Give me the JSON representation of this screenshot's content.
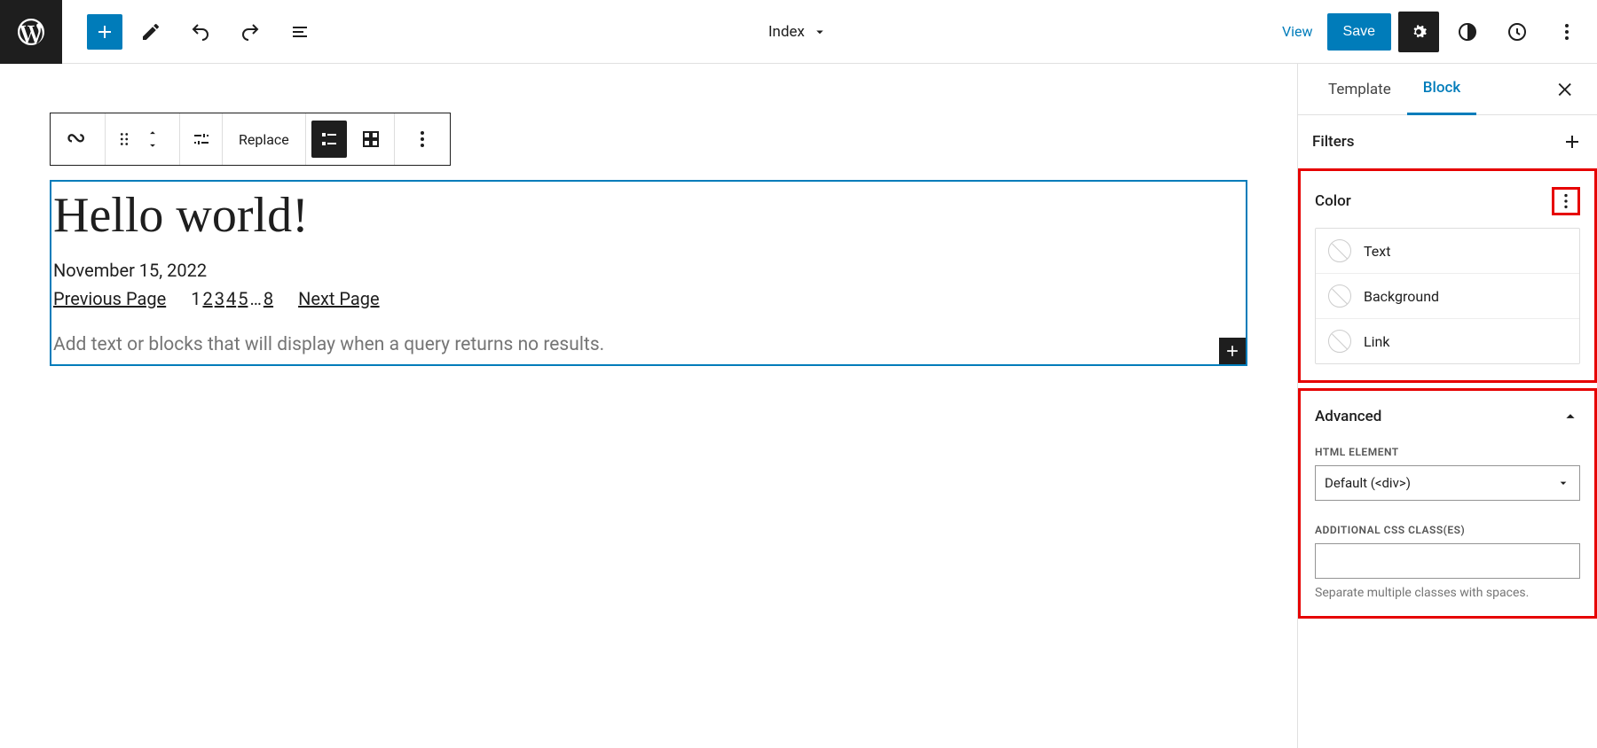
{
  "topbar": {
    "document_label": "Index",
    "view_label": "View",
    "save_label": "Save"
  },
  "toolbar": {
    "replace_label": "Replace"
  },
  "post": {
    "title": "Hello world!",
    "date": "November 15, 2022"
  },
  "pagination": {
    "prev": "Previous Page",
    "next": "Next Page",
    "nums": [
      "1",
      "2",
      "3",
      "4",
      "5",
      "…",
      "8"
    ]
  },
  "no_results_placeholder": "Add text or blocks that will display when a query returns no results.",
  "sidebar": {
    "tabs": {
      "template": "Template",
      "block": "Block"
    },
    "filters_label": "Filters",
    "color": {
      "heading": "Color",
      "text": "Text",
      "background": "Background",
      "link": "Link"
    },
    "advanced": {
      "heading": "Advanced",
      "html_element_label": "HTML ELEMENT",
      "html_element_value": "Default (<div>)",
      "css_label": "ADDITIONAL CSS CLASS(ES)",
      "css_help": "Separate multiple classes with spaces."
    }
  }
}
